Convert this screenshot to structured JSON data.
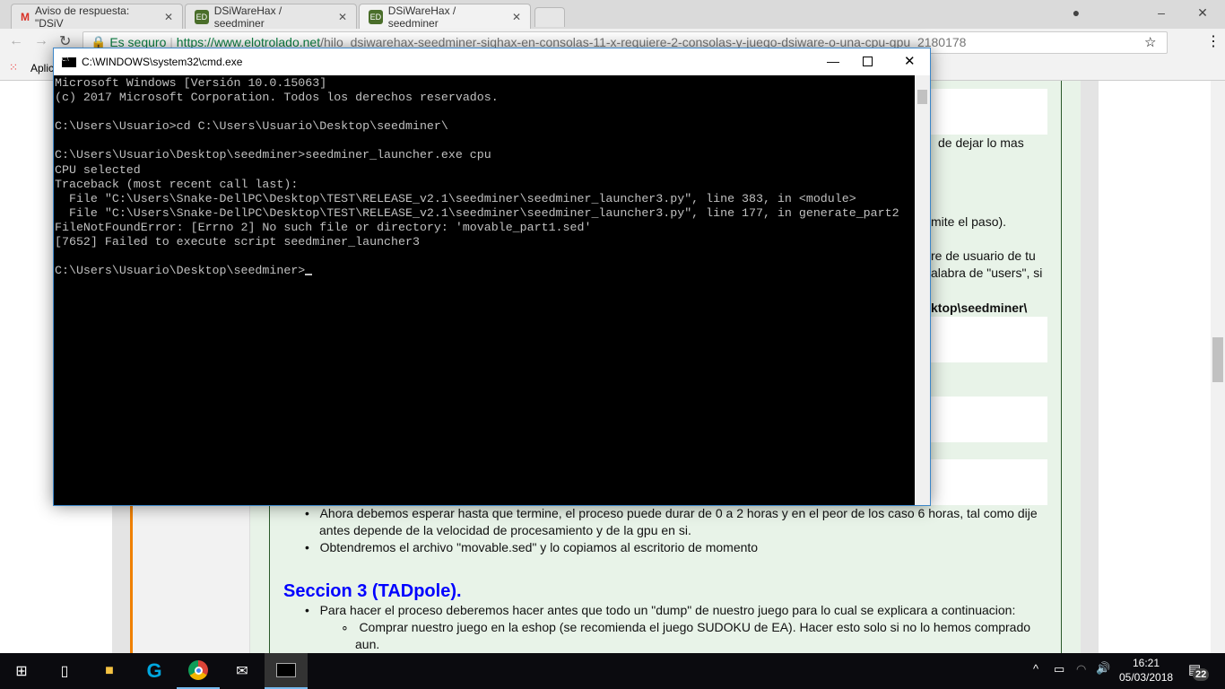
{
  "browser": {
    "tabs": [
      {
        "label": "Aviso de respuesta: \"DSiV",
        "icon": "gmail-icon"
      },
      {
        "label": "DSiWareHax / seedminer",
        "icon": "eol-icon"
      },
      {
        "label": "DSiWareHax / seedminer",
        "icon": "eol-icon",
        "active": true
      }
    ],
    "secure_label": "Es seguro",
    "url_domain": "https://www.elotrolado.net",
    "url_path": "/hilo_dsiwarehax-seedminer-sighax-en-consolas-11-x-requiere-2-consolas-y-juego-dsiware-o-una-cpu-gpu_2180178",
    "bookmarks_apps": "Aplic"
  },
  "page": {
    "frag1": "de dejar lo mas",
    "frag2": "mite el paso).",
    "frag3": "re de usuario de tu",
    "frag4": "alabra de \"users\", si",
    "frag5": "ktop\\seedminer\\",
    "bullets": [
      "Ahora debemos esperar hasta que termine, el proceso puede durar de 0 a 2 horas y en el peor de los caso 6 horas, tal como dije",
      "antes depende de la velocidad de procesamiento y de la gpu en si.",
      "Obtendremos el archivo \"movable.sed\" y lo copiamos al escritorio de momento"
    ],
    "section_heading": "Seccion 3 (TADpole).",
    "bullet2": "Para hacer el proceso deberemos hacer antes que todo un \"dump\" de nuestro juego para lo cual se explicara a continuacion:",
    "sub1": "Comprar nuestro juego en la eshop (se recomienda el juego SUDOKU de EA). Hacer esto solo si no lo hemos comprado",
    "sub1b": "aun.",
    "heading_color": "#0000ff"
  },
  "cmd": {
    "title": "C:\\WINDOWS\\system32\\cmd.exe",
    "lines": [
      "Microsoft Windows [Versión 10.0.15063]",
      "(c) 2017 Microsoft Corporation. Todos los derechos reservados.",
      "",
      "C:\\Users\\Usuario>cd C:\\Users\\Usuario\\Desktop\\seedminer\\",
      "",
      "C:\\Users\\Usuario\\Desktop\\seedminer>seedminer_launcher.exe cpu",
      "CPU selected",
      "Traceback (most recent call last):",
      "  File \"C:\\Users\\Snake-DellPC\\Desktop\\TEST\\RELEASE_v2.1\\seedminer\\seedminer_launcher3.py\", line 383, in <module>",
      "  File \"C:\\Users\\Snake-DellPC\\Desktop\\TEST\\RELEASE_v2.1\\seedminer\\seedminer_launcher3.py\", line 177, in generate_part2",
      "FileNotFoundError: [Errno 2] No such file or directory: 'movable_part1.sed'",
      "[7652] Failed to execute script seedminer_launcher3",
      "",
      "C:\\Users\\Usuario\\Desktop\\seedminer>"
    ]
  },
  "taskbar": {
    "time": "16:21",
    "date": "05/03/2018",
    "notifications": "22"
  }
}
